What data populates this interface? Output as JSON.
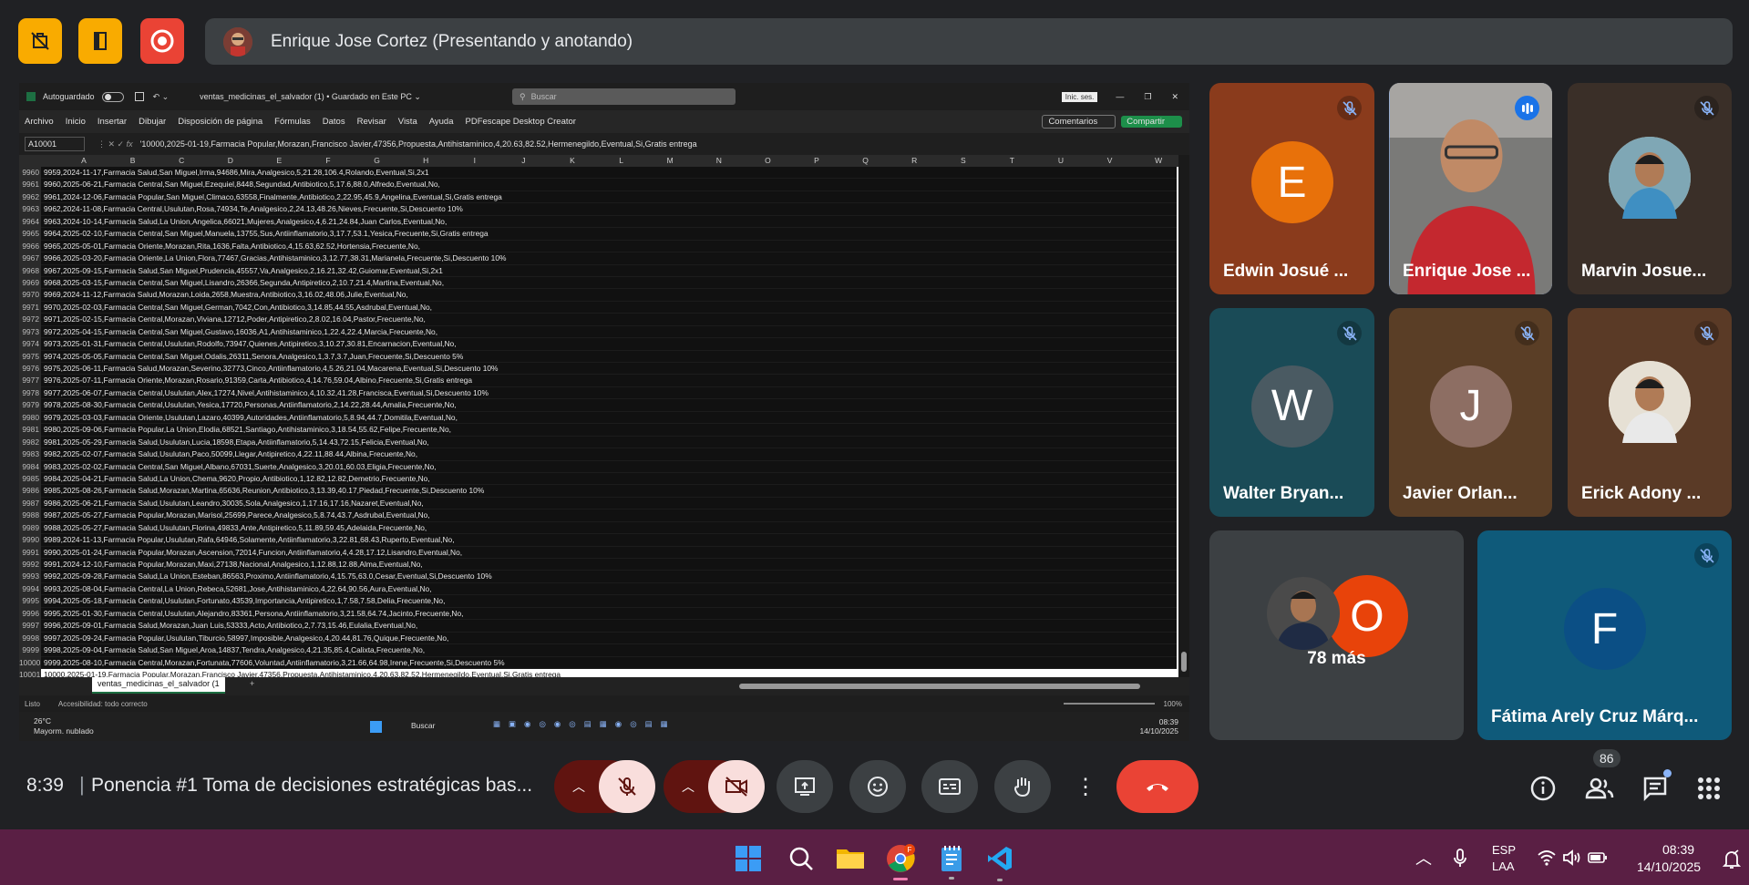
{
  "meet": {
    "presenter_label": "Enrique Jose Cortez (Presentando y anotando)",
    "time": "8:39",
    "separator": "|",
    "meeting_title": "Ponencia #1 Toma de decisiones estratégicas bas...",
    "people_count": "86",
    "tiles": [
      {
        "name": "Edwin Josué ...",
        "initial": "E",
        "bg": "#8a3b1c",
        "avatar_bg": "#e8710a",
        "muted": true
      },
      {
        "name": "Enrique Jose ...",
        "initial": "",
        "bg": "#6b6a6a",
        "avatar_bg": "",
        "muted": false,
        "speaking": true
      },
      {
        "name": "Marvin Josue...",
        "initial": "",
        "bg": "#3a2f28",
        "avatar_bg": "",
        "muted": true
      },
      {
        "name": "Walter Bryan...",
        "initial": "W",
        "bg": "#1a4b57",
        "avatar_bg": "#4a5a62",
        "muted": true
      },
      {
        "name": "Javier Orlan...",
        "initial": "J",
        "bg": "#5a3e26",
        "avatar_bg": "#8d6e63",
        "muted": true
      },
      {
        "name": "Erick Adony ...",
        "initial": "",
        "bg": "#5a3a26",
        "avatar_bg": "",
        "muted": true
      },
      {
        "name": "78 más",
        "initial": "O",
        "bg": "#3c4043",
        "avatar_bg": "#e8430a",
        "muted": false
      },
      {
        "name": "Fátima Arely Cruz Márq...",
        "initial": "F",
        "bg": "#0f5a7a",
        "avatar_bg": "#0b4f85",
        "muted": true
      }
    ]
  },
  "excel": {
    "autosave": "Autoguardado",
    "filename": "ventas_medicinas_el_salvador (1) • Guardado en Este PC ⌄",
    "search": "Buscar",
    "signin": "Inic. ses.",
    "menu": [
      "Archivo",
      "Inicio",
      "Insertar",
      "Dibujar",
      "Disposición de página",
      "Fórmulas",
      "Datos",
      "Revisar",
      "Vista",
      "Ayuda",
      "PDFescape Desktop Creator"
    ],
    "comments": "Comentarios",
    "share": "Compartir",
    "cell_ref": "A10001",
    "formula": "'10000,2025-01-19,Farmacia Popular,Morazan,Francisco Javier,47356,Propuesta,Antihistaminico,4,20.63,82.52,Hermenegildo,Eventual,Si,Gratis entrega",
    "columns": [
      "A",
      "B",
      "C",
      "D",
      "E",
      "F",
      "G",
      "H",
      "I",
      "J",
      "K",
      "L",
      "M",
      "N",
      "O",
      "P",
      "Q",
      "R",
      "S",
      "T",
      "U",
      "V",
      "W"
    ],
    "rows": [
      [
        "9960",
        "9959,2024-11-17,Farmacia Salud,San Miguel,Irma,94686,Mira,Analgesico,5,21.28,106.4,Rolando,Eventual,Si,2x1"
      ],
      [
        "9961",
        "9960,2025-06-21,Farmacia Central,San Miguel,Ezequiel,8448,Segundad,Antibiotico,5,17.6,88.0,Alfredo,Eventual,No,"
      ],
      [
        "9962",
        "9961,2024-12-06,Farmacia Popular,San Miguel,Climaco,63558,Finalmente,Antibiotico,2,22.95,45.9,Angelina,Eventual,Si,Gratis entrega"
      ],
      [
        "9963",
        "9962,2024-11-08,Farmacia Central,Usulutan,Rosa,74934,Te,Analgesico,2,24.13,48.26,Nieves,Frecuente,Si,Descuento 10%"
      ],
      [
        "9964",
        "9963,2024-10-14,Farmacia Salud,La Union,Angelica,66021,Mujeres,Analgesico,4,6.21,24.84,Juan Carlos,Eventual,No,"
      ],
      [
        "9965",
        "9964,2025-02-10,Farmacia Central,San Miguel,Manuela,13755,Sus,Antiinflamatorio,3,17.7,53.1,Yesica,Frecuente,Si,Gratis entrega"
      ],
      [
        "9966",
        "9965,2025-05-01,Farmacia Oriente,Morazan,Rita,1636,Falta,Antibiotico,4,15.63,62.52,Hortensia,Frecuente,No,"
      ],
      [
        "9967",
        "9966,2025-03-20,Farmacia Oriente,La Union,Flora,77467,Gracias,Antihistaminico,3,12.77,38.31,Marianela,Frecuente,Si,Descuento 10%"
      ],
      [
        "9968",
        "9967,2025-09-15,Farmacia Salud,San Miguel,Prudencia,45557,Va,Analgesico,2,16.21,32.42,Guiomar,Eventual,Si,2x1"
      ],
      [
        "9969",
        "9968,2025-03-15,Farmacia Central,San Miguel,Lisandro,26366,Segunda,Antipiretico,2,10.7,21.4,Martina,Eventual,No,"
      ],
      [
        "9970",
        "9969,2024-11-12,Farmacia Salud,Morazan,Loida,2658,Muestra,Antibiotico,3,16.02,48.06,Julie,Eventual,No,"
      ],
      [
        "9971",
        "9970,2025-02-03,Farmacia Central,San Miguel,German,7042,Con,Antibiotico,3,14.85,44.55,Asdrubal,Eventual,No,"
      ],
      [
        "9972",
        "9971,2025-02-15,Farmacia Central,Morazan,Viviana,12712,Poder,Antipiretico,2,8.02,16.04,Pastor,Frecuente,No,"
      ],
      [
        "9973",
        "9972,2025-04-15,Farmacia Central,San Miguel,Gustavo,16036,A1,Antihistaminico,1,22.4,22.4,Marcia,Frecuente,No,"
      ],
      [
        "9974",
        "9973,2025-01-31,Farmacia Central,Usulutan,Rodolfo,73947,Quienes,Antipiretico,3,10.27,30.81,Encarnacion,Eventual,No,"
      ],
      [
        "9975",
        "9974,2025-05-05,Farmacia Central,San Miguel,Odalis,26311,Senora,Analgesico,1,3.7,3.7,Juan,Frecuente,Si,Descuento 5%"
      ],
      [
        "9976",
        "9975,2025-06-11,Farmacia Salud,Morazan,Severino,32773,Cinco,Antiinflamatorio,4,5.26,21.04,Macarena,Eventual,Si,Descuento 10%"
      ],
      [
        "9977",
        "9976,2025-07-11,Farmacia Oriente,Morazan,Rosario,91359,Carta,Antibiotico,4,14.76,59.04,Albino,Frecuente,Si,Gratis entrega"
      ],
      [
        "9978",
        "9977,2025-06-07,Farmacia Central,Usulutan,Alex,17274,Nivel,Antihistaminico,4,10.32,41.28,Francisca,Eventual,Si,Descuento 10%"
      ],
      [
        "9979",
        "9978,2025-08-30,Farmacia Central,Usulutan,Yesica,17720,Personas,Antiinflamatorio,2,14.22,28.44,Amalia,Frecuente,No,"
      ],
      [
        "9980",
        "9979,2025-03-03,Farmacia Oriente,Usulutan,Lazaro,40399,Autoridades,Antiinflamatorio,5,8.94,44.7,Domitila,Eventual,No,"
      ],
      [
        "9981",
        "9980,2025-09-06,Farmacia Popular,La Union,Elodia,68521,Santiago,Antihistaminico,3,18.54,55.62,Felipe,Frecuente,No,"
      ],
      [
        "9982",
        "9981,2025-05-29,Farmacia Salud,Usulutan,Lucia,18598,Etapa,Antiinflamatorio,5,14.43,72.15,Felicia,Eventual,No,"
      ],
      [
        "9983",
        "9982,2025-02-07,Farmacia Salud,Usulutan,Paco,50099,Llegar,Antipiretico,4,22.11,88.44,Albina,Frecuente,No,"
      ],
      [
        "9984",
        "9983,2025-02-02,Farmacia Central,San Miguel,Albano,67031,Suerte,Analgesico,3,20.01,60.03,Eligia,Frecuente,No,"
      ],
      [
        "9985",
        "9984,2025-04-21,Farmacia Salud,La Union,Chema,9620,Propio,Antibiotico,1,12.82,12.82,Demetrio,Frecuente,No,"
      ],
      [
        "9986",
        "9985,2025-08-26,Farmacia Salud,Morazan,Martina,65636,Reunion,Antibiotico,3,13.39,40.17,Piedad,Frecuente,Si,Descuento 10%"
      ],
      [
        "9987",
        "9986,2025-06-21,Farmacia Salud,Usulutan,Leandro,30035,Sola,Analgesico,1,17.16,17.16,Nazaret,Eventual,No,"
      ],
      [
        "9988",
        "9987,2025-05-27,Farmacia Popular,Morazan,Marisol,25699,Parece,Analgesico,5,8.74,43.7,Asdrubal,Eventual,No,"
      ],
      [
        "9989",
        "9988,2025-05-27,Farmacia Salud,Usulutan,Florina,49833,Ante,Antipiretico,5,11.89,59.45,Adelaida,Frecuente,No,"
      ],
      [
        "9990",
        "9989,2024-11-13,Farmacia Popular,Usulutan,Rafa,64946,Solamente,Antiinflamatorio,3,22.81,68.43,Ruperto,Eventual,No,"
      ],
      [
        "9991",
        "9990,2025-01-24,Farmacia Popular,Morazan,Ascension,72014,Funcion,Antiinflamatorio,4,4.28,17.12,Lisandro,Eventual,No,"
      ],
      [
        "9992",
        "9991,2024-12-10,Farmacia Popular,Morazan,Maxi,27138,Nacional,Analgesico,1,12.88,12.88,Alma,Eventual,No,"
      ],
      [
        "9993",
        "9992,2025-09-28,Farmacia Salud,La Union,Esteban,86563,Proximo,Antiinflamatorio,4,15.75,63.0,Cesar,Eventual,Si,Descuento 10%"
      ],
      [
        "9994",
        "9993,2025-08-04,Farmacia Central,La Union,Rebeca,52681,Jose,Antihistaminico,4,22.64,90.56,Aura,Eventual,No,"
      ],
      [
        "9995",
        "9994,2025-05-18,Farmacia Central,Usulutan,Fortunato,43539,Importancia,Antipiretico,1,7.58,7.58,Delia,Frecuente,No,"
      ],
      [
        "9996",
        "9995,2025-01-30,Farmacia Central,Usulutan,Alejandro,83361,Persona,Antiinflamatorio,3,21.58,64.74,Jacinto,Frecuente,No,"
      ],
      [
        "9997",
        "9996,2025-09-01,Farmacia Salud,Morazan,Juan Luis,53333,Acto,Antibiotico,2,7.73,15.46,Eulalia,Eventual,No,"
      ],
      [
        "9998",
        "9997,2025-09-24,Farmacia Popular,Usulutan,Tiburcio,58997,Imposible,Analgesico,4,20.44,81.76,Quique,Frecuente,No,"
      ],
      [
        "9999",
        "9998,2025-09-04,Farmacia Salud,San Miguel,Aroa,14837,Tendra,Analgesico,4,21.35,85.4,Calixta,Frecuente,No,"
      ],
      [
        "10000",
        "9999,2025-08-10,Farmacia Central,Morazan,Fortunata,77606,Voluntad,Antiinflamatorio,3,21.66,64.98,Irene,Frecuente,Si,Descuento 5%"
      ],
      [
        "10001",
        "10000,2025-01-19,Farmacia Popular,Morazan,Francisco Javier,47356,Propuesta,Antihistaminico,4,20.63,82.52,Hermenegildo,Eventual,Si,Gratis entrega"
      ]
    ],
    "sheet_tab": "ventas_medicinas_el_salvador (1",
    "status_left": "Listo",
    "accessibility": "Accesibilidad: todo correcto",
    "zoom": "100%",
    "weather_temp": "26°C",
    "weather_desc": "Mayorm. nublado",
    "inner_search": "Buscar",
    "inner_time": "08:39",
    "inner_date": "14/10/2025"
  },
  "taskbar": {
    "lang1": "ESP",
    "lang2": "LAA",
    "time": "08:39",
    "date": "14/10/2025"
  },
  "colors": {
    "accent_yellow": "#f9ab00",
    "record_red": "#ea4335",
    "end_call": "#ea4335",
    "muted_ctrl": "#f9dedc",
    "taskbar": "#5a1f44"
  }
}
